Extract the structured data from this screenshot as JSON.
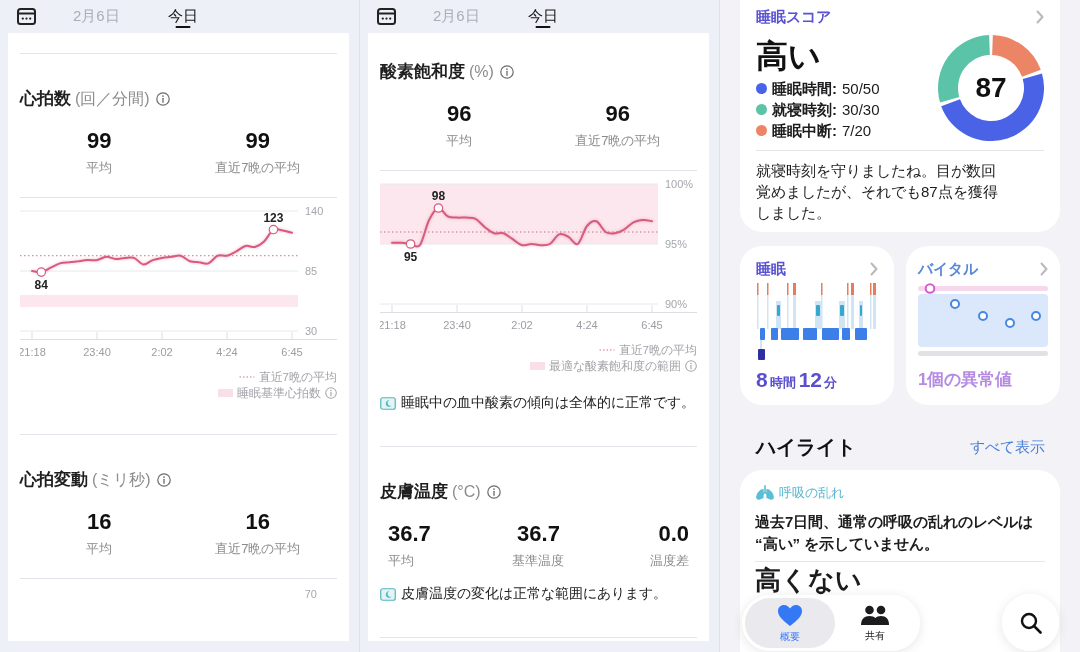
{
  "panels": [
    {
      "tabs": [
        {
          "label": "2月6日",
          "selected": false
        },
        {
          "label": "今日",
          "selected": true
        }
      ],
      "sections": [
        {
          "title": "心拍数",
          "unit": "(回／分間)",
          "info": true,
          "stats": [
            {
              "value": "99",
              "label": "平均"
            },
            {
              "value": "99",
              "label": "直近7晩の平均"
            }
          ],
          "chart_data": {
            "type": "line",
            "categories": [
              "21:18",
              null,
              null,
              null,
              null,
              null,
              null,
              "23:40",
              null,
              null,
              null,
              null,
              null,
              null,
              "2:02",
              null,
              null,
              null,
              null,
              null,
              null,
              "4:24",
              null,
              null,
              null,
              null,
              null,
              null,
              "6:45"
            ],
            "ylim": [
              30,
              140
            ],
            "yticks": [
              140,
              85,
              30
            ],
            "series": [
              {
                "color": "#d85a7f",
                "values": [
                  85,
                  84,
                  88,
                  92,
                  93,
                  94,
                  95,
                  95,
                  98,
                  96,
                  97,
                  97,
                  91,
                  95,
                  97,
                  98,
                  99,
                  94,
                  93,
                  92,
                  99,
                  99,
                  103,
                  108,
                  107,
                  112,
                  123,
                  122,
                  120
                ]
              }
            ],
            "bands": [
              {
                "axis": "y",
                "from": 52,
                "to": 63
              }
            ],
            "ref_lines": [
              {
                "axis": "y",
                "value": 99
              }
            ],
            "annotations": [
              {
                "y": 84,
                "text": "84"
              },
              {
                "y": 123,
                "text": "123"
              }
            ]
          },
          "legend": [
            {
              "kind": "dotted",
              "label": "直近7晩の平均"
            },
            {
              "kind": "band",
              "label": "睡眠基準心拍数",
              "info": true
            }
          ]
        },
        {
          "title": "心拍変動",
          "unit": "(ミリ秒)",
          "info": true,
          "stats": [
            {
              "value": "16",
              "label": "平均"
            },
            {
              "value": "16",
              "label": "直近7晩の平均"
            }
          ],
          "axis_tick": "70"
        }
      ]
    },
    {
      "tabs": [
        {
          "label": "2月6日",
          "selected": false
        },
        {
          "label": "今日",
          "selected": true
        }
      ],
      "sections": [
        {
          "title": "酸素飽和度",
          "unit": "(%)",
          "info": true,
          "stats": [
            {
              "value": "96",
              "label": "平均"
            },
            {
              "value": "96",
              "label": "直近7晩の平均"
            }
          ],
          "chart_data": {
            "type": "line",
            "categories": [
              "21:18",
              null,
              null,
              null,
              null,
              null,
              null,
              "23:40",
              null,
              null,
              null,
              null,
              null,
              null,
              "2:02",
              null,
              null,
              null,
              null,
              null,
              null,
              "4:24",
              null,
              null,
              null,
              null,
              null,
              null,
              "6:45"
            ],
            "ylim": [
              90,
              100
            ],
            "yticks": [
              {
                "value": 100,
                "label": "100%"
              },
              {
                "value": 95,
                "label": "95%"
              },
              {
                "value": 90,
                "label": "90%"
              }
            ],
            "series": [
              {
                "color": "#d85a7f",
                "values": [
                  95.1,
                  95.1,
                  95,
                  94.9,
                  97,
                  98,
                  97.3,
                  97.2,
                  97.2,
                  97.1,
                  96.4,
                  95.9,
                  95.9,
                  95.4,
                  94.9,
                  95,
                  94.9,
                  95,
                  95.8,
                  95.6,
                  95,
                  96.5,
                  96.9,
                  96,
                  95.9,
                  96.2,
                  96.8,
                  97,
                  96.9
                ]
              }
            ],
            "bands": [
              {
                "axis": "y",
                "from": 95,
                "to": 100
              }
            ],
            "ref_lines": [
              {
                "axis": "y",
                "value": 96
              }
            ],
            "annotations": [
              {
                "y": 95,
                "text": "95"
              },
              {
                "y": 98,
                "text": "98"
              }
            ]
          },
          "legend": [
            {
              "kind": "dotted",
              "label": "直近7晩の平均"
            },
            {
              "kind": "band",
              "label": "最適な酸素飽和度の範囲",
              "info": true
            }
          ],
          "insight": "睡眠中の血中酸素の傾向は全体的に正常です。"
        },
        {
          "title": "皮膚温度",
          "unit": "(°C)",
          "info": true,
          "stats": [
            {
              "value": "36.7",
              "label": "平均"
            },
            {
              "value": "36.7",
              "label": "基準温度"
            },
            {
              "value": "0.0",
              "label": "温度差"
            }
          ],
          "insight": "皮膚温度の変化は正常な範囲にあります。"
        }
      ]
    }
  ],
  "summary": {
    "sleep_score": {
      "title": "睡眠スコア",
      "rating": "高い",
      "legend": [
        {
          "label": "睡眠時間:",
          "value": "50/50",
          "color": "#4a63e6"
        },
        {
          "label": "就寝時刻:",
          "value": "30/30",
          "color": "#5bc3a8"
        },
        {
          "label": "睡眠中断:",
          "value": "7/20",
          "color": "#ec8466"
        }
      ],
      "chart_data": {
        "type": "donut",
        "values": [
          50,
          30,
          20
        ]
      },
      "score": "87",
      "message": "就寝時刻を守りましたね。目が数回覚めましたが、それでも87点を獲得しました。"
    },
    "tiles": [
      {
        "kind": "sleep",
        "title": "睡眠",
        "value_parts": [
          {
            "number": "8",
            "unit": "時間"
          },
          {
            "number": "12",
            "unit": "分"
          }
        ]
      },
      {
        "kind": "vitals",
        "title": "バイタル",
        "value": "1個の異常値"
      }
    ],
    "highlights": {
      "title": "ハイライト",
      "link": "すべて表示",
      "cards": [
        {
          "category": "呼吸の乱れ",
          "text": "過去7日間、通常の呼吸の乱れのレベルは“高い” を示していません。",
          "result": "高くない"
        }
      ]
    },
    "tab_bar": {
      "items": [
        {
          "kind": "heart",
          "label": "概要",
          "selected": true
        },
        {
          "kind": "people",
          "label": "共有",
          "selected": false
        }
      ]
    }
  }
}
